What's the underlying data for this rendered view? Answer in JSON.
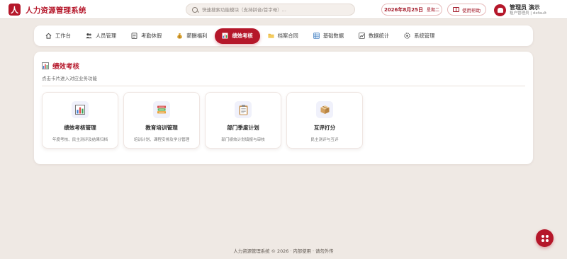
{
  "header": {
    "logo_char": "人",
    "app_title": "人力资源管理系统",
    "search_placeholder": "快速搜索功能模块（支持拼音/首字母）...",
    "date": "2026年8月25日",
    "weekday": "星期二",
    "help_label": "使用帮助",
    "user_name": "管理员 演示",
    "user_role": "租户管理员 | default"
  },
  "nav": {
    "items": [
      {
        "label": "工作台",
        "icon": "home-icon"
      },
      {
        "label": "人员管理",
        "icon": "people-icon"
      },
      {
        "label": "考勤休假",
        "icon": "calendar-icon"
      },
      {
        "label": "薪酬福利",
        "icon": "moneybag-icon"
      },
      {
        "label": "绩效考核",
        "icon": "chart-icon",
        "active": true
      },
      {
        "label": "档案合同",
        "icon": "folder-icon"
      },
      {
        "label": "基础数据",
        "icon": "database-icon"
      },
      {
        "label": "数据统计",
        "icon": "stats-icon"
      },
      {
        "label": "系统管理",
        "icon": "gear-icon"
      }
    ]
  },
  "main": {
    "title": "绩效考核",
    "subtitle": "点击卡片进入对应业务功能",
    "cards": [
      {
        "title": "绩效考核管理",
        "desc": "年度考核、民主测评及结果归档",
        "icon": "bar-chart-icon"
      },
      {
        "title": "教育培训管理",
        "desc": "培训计划、课程安排及学分管理",
        "icon": "books-icon"
      },
      {
        "title": "部门季度计划",
        "desc": "部门绩效计划填报与审核",
        "icon": "clipboard-icon"
      },
      {
        "title": "互评打分",
        "desc": "民主测评与互评",
        "icon": "package-icon"
      }
    ]
  },
  "footer": {
    "text": "人力资源管理系统 © 2026 · 内部使用 · 请勿外传"
  },
  "colors": {
    "brand": "#b5172a",
    "background": "#efe9e4"
  }
}
